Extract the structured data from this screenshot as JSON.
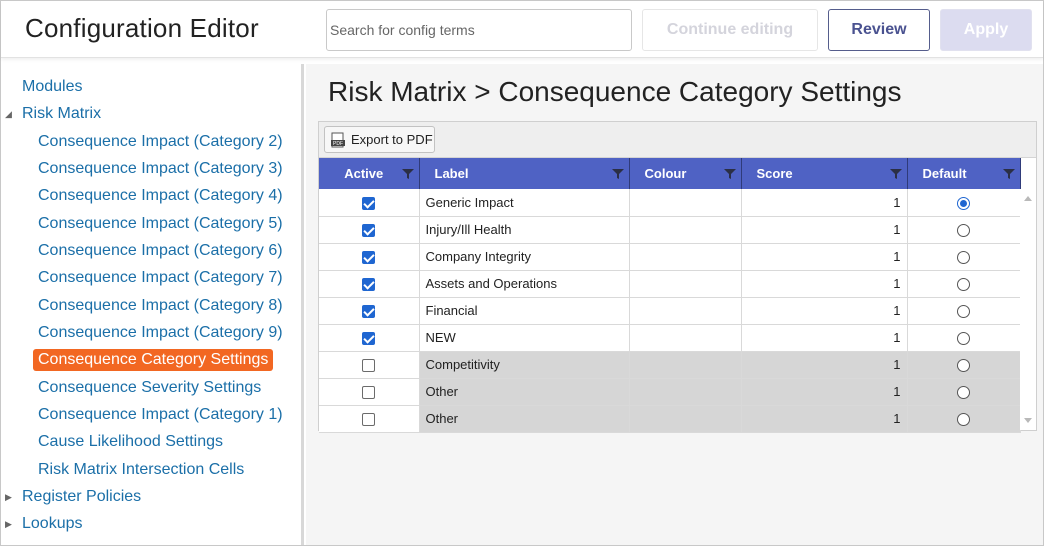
{
  "header": {
    "title": "Configuration Editor",
    "search_placeholder": "Search for config terms",
    "continue_label": "Continue editing",
    "review_label": "Review",
    "apply_label": "Apply"
  },
  "sidebar": {
    "items": [
      {
        "label": "Modules",
        "caret": "",
        "level": 0
      },
      {
        "label": "Risk Matrix",
        "caret": "expanded",
        "level": 0
      },
      {
        "label": "Consequence Impact (Category 2)",
        "level": 1
      },
      {
        "label": "Consequence Impact (Category 3)",
        "level": 1
      },
      {
        "label": "Consequence Impact (Category 4)",
        "level": 1
      },
      {
        "label": "Consequence Impact (Category 5)",
        "level": 1
      },
      {
        "label": "Consequence Impact (Category 6)",
        "level": 1
      },
      {
        "label": "Consequence Impact (Category 7)",
        "level": 1
      },
      {
        "label": "Consequence Impact (Category 8)",
        "level": 1
      },
      {
        "label": "Consequence Impact (Category 9)",
        "level": 1
      },
      {
        "label": "Consequence Category Settings",
        "level": 1,
        "selected": true
      },
      {
        "label": "Consequence Severity Settings",
        "level": 1
      },
      {
        "label": "Consequence Impact (Category 1)",
        "level": 1
      },
      {
        "label": "Cause Likelihood Settings",
        "level": 1
      },
      {
        "label": "Risk Matrix Intersection Cells",
        "level": 1
      },
      {
        "label": "Register Policies",
        "caret": "collapsed",
        "level": 0
      },
      {
        "label": "Lookups",
        "caret": "collapsed",
        "level": 0
      }
    ],
    "selected_color": "#f26722",
    "link_color": "#1b6fa8"
  },
  "main": {
    "title": "Risk Matrix > Consequence Category Settings",
    "export_label": "Export to PDF",
    "columns": [
      "Active",
      "Label",
      "Colour",
      "Score",
      "Default"
    ],
    "header_color": "#4f62c4",
    "rows": [
      {
        "active": true,
        "label": "Generic Impact",
        "colour": "",
        "score": "1",
        "default": true
      },
      {
        "active": true,
        "label": "Injury/Ill Health",
        "colour": "",
        "score": "1",
        "default": false
      },
      {
        "active": true,
        "label": "Company Integrity",
        "colour": "",
        "score": "1",
        "default": false
      },
      {
        "active": true,
        "label": "Assets and Operations",
        "colour": "",
        "score": "1",
        "default": false
      },
      {
        "active": true,
        "label": "Financial",
        "colour": "",
        "score": "1",
        "default": false
      },
      {
        "active": true,
        "label": "NEW",
        "colour": "",
        "score": "1",
        "default": false
      },
      {
        "active": false,
        "label": "Competitivity",
        "colour": "",
        "score": "1",
        "default": false
      },
      {
        "active": false,
        "label": "Other",
        "colour": "",
        "score": "1",
        "default": false
      },
      {
        "active": false,
        "label": "Other",
        "colour": "",
        "score": "1",
        "default": false
      }
    ]
  }
}
